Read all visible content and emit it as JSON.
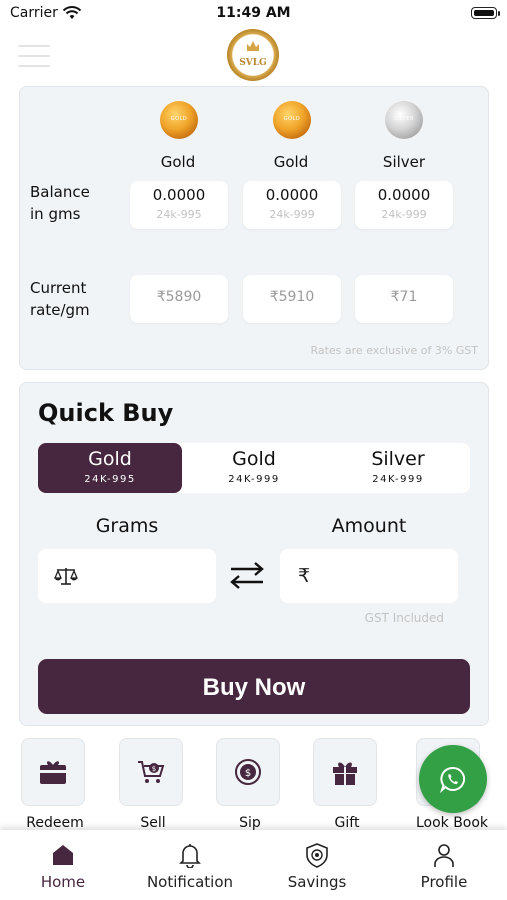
{
  "status_bar": {
    "carrier": "Carrier",
    "time": "11:49 AM"
  },
  "logo": {
    "text": "SVLG"
  },
  "holdings": {
    "columns": [
      {
        "coin_label": "GOLD",
        "name": "Gold",
        "balance": "0.0000",
        "purity": "24k-995",
        "rate": "₹5890"
      },
      {
        "coin_label": "GOLD",
        "name": "Gold",
        "balance": "0.0000",
        "purity": "24k-999",
        "rate": "₹5910"
      },
      {
        "coin_label": "SILVER",
        "name": "Silver",
        "balance": "0.0000",
        "purity": "24k-999",
        "rate": "₹71"
      }
    ],
    "balance_label_line1": "Balance",
    "balance_label_line2": "in gms",
    "rate_label_line1": "Current",
    "rate_label_line2": "rate/gm",
    "gst_note": "Rates are exclusive of 3% GST"
  },
  "quick_buy": {
    "title": "Quick Buy",
    "options": [
      {
        "metal": "Gold",
        "purity": "24K-995",
        "active": true
      },
      {
        "metal": "Gold",
        "purity": "24K-999",
        "active": false
      },
      {
        "metal": "Silver",
        "purity": "24K-999",
        "active": false
      }
    ],
    "grams_label": "Grams",
    "amount_label": "Amount",
    "currency_symbol": "₹",
    "gst_included": "GST Included",
    "buy_button": "Buy Now"
  },
  "actions": [
    {
      "label": "Redeem",
      "icon": "gift-card-icon"
    },
    {
      "label": "Sell",
      "icon": "cart-icon"
    },
    {
      "label": "Sip",
      "icon": "coin-cycle-icon"
    },
    {
      "label": "Gift",
      "icon": "gift-box-icon"
    },
    {
      "label": "Look Book",
      "icon": "book-icon"
    }
  ],
  "tabs": [
    {
      "label": "Home",
      "icon": "home-icon",
      "active": true
    },
    {
      "label": "Notification",
      "icon": "bell-icon",
      "active": false
    },
    {
      "label": "Savings",
      "icon": "shield-icon",
      "active": false
    },
    {
      "label": "Profile",
      "icon": "person-icon",
      "active": false
    }
  ],
  "colors": {
    "primary": "#46273f",
    "card_bg": "#f1f4f7",
    "whatsapp": "#33a046"
  }
}
